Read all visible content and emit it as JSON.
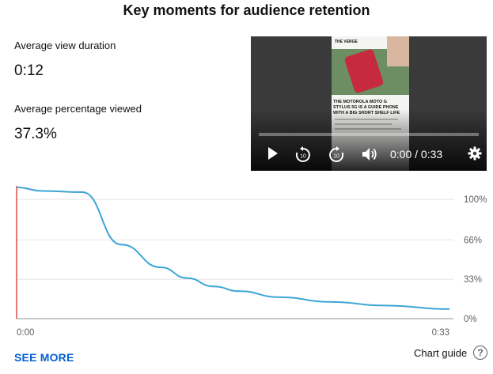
{
  "header": {
    "title": "Key moments for audience retention"
  },
  "metrics": {
    "avg_view_duration_label": "Average view duration",
    "avg_view_duration_value": "0:12",
    "avg_pct_viewed_label": "Average percentage viewed",
    "avg_pct_viewed_value": "37.3%"
  },
  "player": {
    "time_display": "0:00 / 0:33",
    "progress_fraction": 0.0,
    "thumbnail": {
      "brand": "THE VERGE",
      "headline": "THE MOTOROLA MOTO G STYLUS 5G IS A GUIDE PHONE WITH A BIG SHORT SHELF LIFE"
    },
    "icons": [
      "play-icon",
      "rewind-10-icon",
      "forward-10-icon",
      "volume-icon",
      "settings-gear-icon"
    ]
  },
  "chart_data": {
    "type": "line",
    "x_tick_labels": [
      "0:00",
      "0:33"
    ],
    "y_tick_labels": [
      "100%",
      "66%",
      "33%",
      "0%"
    ],
    "x_seconds": [
      0,
      2,
      5,
      8,
      11,
      13,
      15,
      17,
      20,
      24,
      28,
      33
    ],
    "y_percent": [
      110,
      107,
      106,
      62,
      43,
      34,
      27,
      23,
      18,
      14,
      11,
      8
    ],
    "ylim": [
      0,
      110
    ],
    "xlim": [
      0,
      33
    ],
    "grid": true,
    "line_color": "#3ea6d5",
    "start_marker_color": "#e05a52"
  },
  "footer": {
    "see_more_label": "SEE MORE",
    "chart_guide_label": "Chart guide",
    "help_glyph": "?"
  }
}
